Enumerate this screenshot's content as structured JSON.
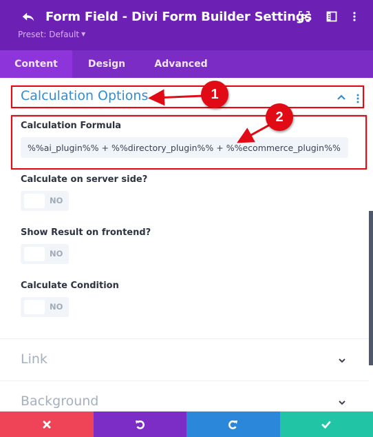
{
  "header": {
    "title": "Form Field - Divi Form Builder Settings",
    "preset_label": "Preset: Default",
    "icons": [
      "back-icon",
      "focus-mode-icon",
      "split-view-icon",
      "more-options-icon"
    ],
    "background_color": "#6c21b4"
  },
  "tabs": [
    {
      "label": "Content",
      "active": true
    },
    {
      "label": "Design",
      "active": false
    },
    {
      "label": "Advanced",
      "active": false
    }
  ],
  "section": {
    "title": "Calculation Options",
    "expanded": true,
    "title_color": "#2e8dd6"
  },
  "fields": {
    "formula": {
      "label": "Calculation Formula",
      "value": "%%ai_plugin%% + %%directory_plugin%% + %%ecommerce_plugin%%"
    },
    "toggles": [
      {
        "label": "Calculate on server side?",
        "state": "NO"
      },
      {
        "label": "Show Result on frontend?",
        "state": "NO"
      },
      {
        "label": "Calculate Condition",
        "state": "NO"
      }
    ]
  },
  "collapsed_groups": [
    {
      "title": "Link"
    },
    {
      "title": "Background"
    }
  ],
  "annotations": [
    {
      "number": "1",
      "target": "Calculation Options header"
    },
    {
      "number": "2",
      "target": "Calculation Formula field"
    }
  ],
  "footer": {
    "buttons": [
      {
        "name": "cancel",
        "icon": "close-icon",
        "color": "#ef4358"
      },
      {
        "name": "undo",
        "icon": "undo-icon",
        "color": "#7c2dc6"
      },
      {
        "name": "redo",
        "icon": "redo-icon",
        "color": "#2b87da"
      },
      {
        "name": "save",
        "icon": "check-icon",
        "color": "#21c5a5"
      }
    ]
  }
}
